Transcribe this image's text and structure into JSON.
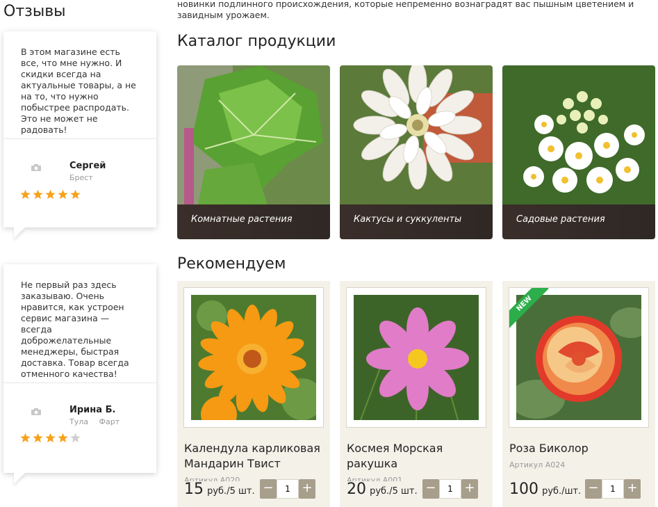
{
  "reviews": {
    "title": "Отзывы",
    "items": [
      {
        "text": "В этом магазине есть все, что мне нужно. И скидки всегда на актуальные товары, а не на то, что нужно побыстрее распродать. Это не может не радовать!",
        "name": "Сергей",
        "location": [
          "Брест"
        ],
        "rating": 5
      },
      {
        "text": "Не первый раз здесь заказываю. Очень нравится, как устроен сервис магазина — всегда доброжелательные менеджеры, быстрая доставка. Товар всегда отменного качества!",
        "name": "Ирина Б.",
        "location": [
          "Тула",
          "Фарт"
        ],
        "rating": 4
      }
    ]
  },
  "intro_text": "новинки подлинного происхождения, которые непременно вознаградят вас пышным цветением и завидным урожаем.",
  "catalog": {
    "title": "Каталог продукции",
    "items": [
      {
        "label": "Комнатные растения"
      },
      {
        "label": "Кактусы и суккуленты"
      },
      {
        "label": "Садовые растения"
      }
    ]
  },
  "recommended": {
    "title": "Рекомендуем",
    "items": [
      {
        "name": "Календула карликовая Мандарин Твист",
        "sku": "Артикул A020",
        "price": "15",
        "unit": "руб./5 шт.",
        "qty": "1",
        "badge": ""
      },
      {
        "name": "Космея Морская ракушка",
        "sku": "Артикул A001",
        "price": "20",
        "unit": "руб./5 шт.",
        "qty": "1",
        "badge": ""
      },
      {
        "name": "Роза Биколор",
        "sku": "Артикул A024",
        "price": "100",
        "unit": "руб./шт.",
        "qty": "1",
        "badge": "NEW"
      }
    ]
  },
  "stepper": {
    "minus": "−",
    "plus": "+"
  },
  "colors": {
    "star": "#f7a21b",
    "star_empty": "#cfcfcf",
    "stepper": "#a79e8c",
    "ribbon": "#2cae4a",
    "card_bg": "#f4f1e9"
  }
}
